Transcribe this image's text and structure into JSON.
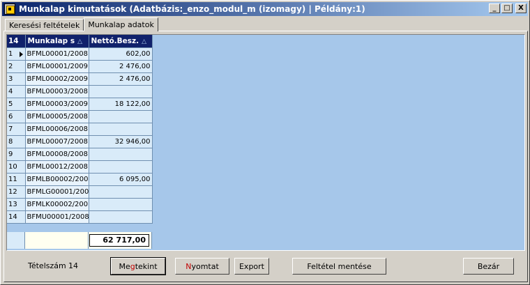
{
  "window": {
    "title": "Munkalap kimutatások  (Adatbázis:_enzo_modul_m (izomagy) | Példány:1)",
    "buttons": {
      "minimize": "_",
      "maximize": "□",
      "close": "X"
    }
  },
  "tabs": [
    {
      "label": "Keresési feltételek",
      "active": false
    },
    {
      "label": "Munkalap adatok",
      "active": true
    }
  ],
  "grid": {
    "row_count_header": "14",
    "columns": [
      "Munkalap s",
      "Nettó.Besz."
    ],
    "sort_indicator": "△",
    "rows": [
      {
        "num": "1",
        "code": "BFML00001/2008",
        "value": "602,00",
        "current": true
      },
      {
        "num": "2",
        "code": "BFML00001/2009",
        "value": "2 476,00"
      },
      {
        "num": "3",
        "code": "BFML00002/2009",
        "value": "2 476,00"
      },
      {
        "num": "4",
        "code": "BFML00003/2008",
        "value": ""
      },
      {
        "num": "5",
        "code": "BFML00003/2009",
        "value": "18 122,00"
      },
      {
        "num": "6",
        "code": "BFML00005/2008",
        "value": ""
      },
      {
        "num": "7",
        "code": "BFML00006/2008",
        "value": ""
      },
      {
        "num": "8",
        "code": "BFML00007/2008",
        "value": "32 946,00"
      },
      {
        "num": "9",
        "code": "BFML00008/2008",
        "value": ""
      },
      {
        "num": "10",
        "code": "BFML00012/2008",
        "value": ""
      },
      {
        "num": "11",
        "code": "BFMLB00002/200",
        "value": "6 095,00"
      },
      {
        "num": "12",
        "code": "BFMLG00001/200",
        "value": ""
      },
      {
        "num": "13",
        "code": "BFMLK00002/200",
        "value": ""
      },
      {
        "num": "14",
        "code": "BFMU00001/2008",
        "value": ""
      }
    ],
    "total": "62 717,00"
  },
  "footer": {
    "count_label": "Tételszám",
    "count_value": "14",
    "buttons": {
      "view_pre": "Me",
      "view_accent": "g",
      "view_post": "tekint",
      "print_accent": "N",
      "print_post": "yomtat",
      "export": "Export",
      "save_filter": "Feltétel mentése",
      "close": "Bezár"
    }
  }
}
